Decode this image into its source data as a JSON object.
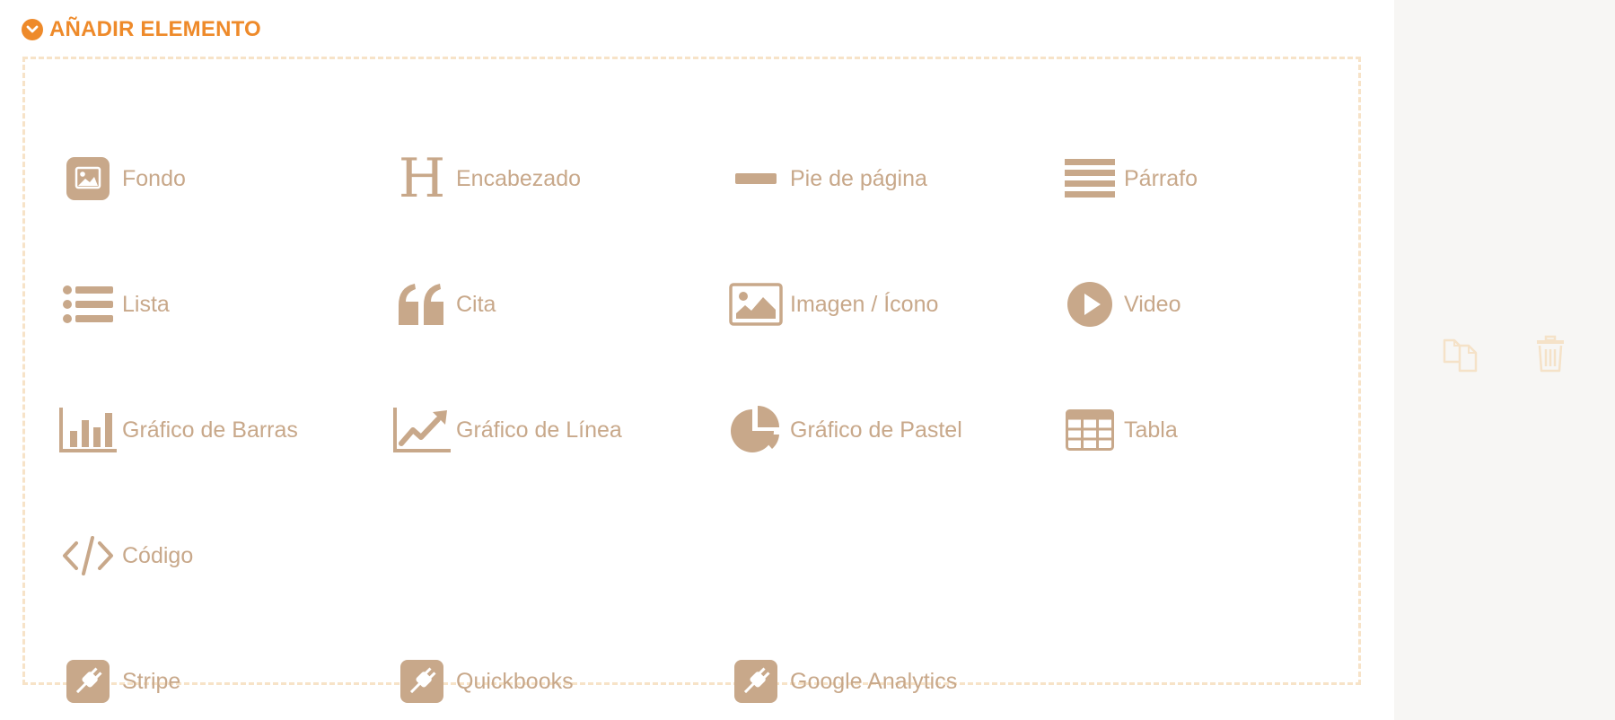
{
  "header": {
    "title": "AÑADIR ELEMENTO",
    "icon": "chevron-down-circle-icon",
    "accent": "#ee8a2a"
  },
  "colors": {
    "item": "#c8a88a",
    "dashed_border": "#f7e3c8",
    "side_panel": "#f7f6f4",
    "action_icons": "#f5e2c8"
  },
  "elements": [
    {
      "label": "Fondo",
      "icon": "background-image-icon"
    },
    {
      "label": "Encabezado",
      "icon": "heading-icon"
    },
    {
      "label": "Pie de página",
      "icon": "footer-icon"
    },
    {
      "label": "Párrafo",
      "icon": "paragraph-icon"
    },
    {
      "label": "Lista",
      "icon": "list-icon"
    },
    {
      "label": "Cita",
      "icon": "quote-icon"
    },
    {
      "label": "Imagen / Ícono",
      "icon": "image-icon"
    },
    {
      "label": "Video",
      "icon": "play-icon"
    },
    {
      "label": "Gráfico de Barras",
      "icon": "bar-chart-icon"
    },
    {
      "label": "Gráfico de Línea",
      "icon": "line-chart-icon"
    },
    {
      "label": "Gráfico de Pastel",
      "icon": "pie-chart-icon"
    },
    {
      "label": "Tabla",
      "icon": "table-icon"
    },
    {
      "label": "Código",
      "icon": "code-icon"
    }
  ],
  "integrations": [
    {
      "label": "Stripe",
      "icon": "plug-icon"
    },
    {
      "label": "Quickbooks",
      "icon": "plug-icon"
    },
    {
      "label": "Google Analytics",
      "icon": "plug-icon"
    }
  ],
  "side_actions": [
    {
      "icon": "copy-icon"
    },
    {
      "icon": "trash-icon"
    }
  ]
}
